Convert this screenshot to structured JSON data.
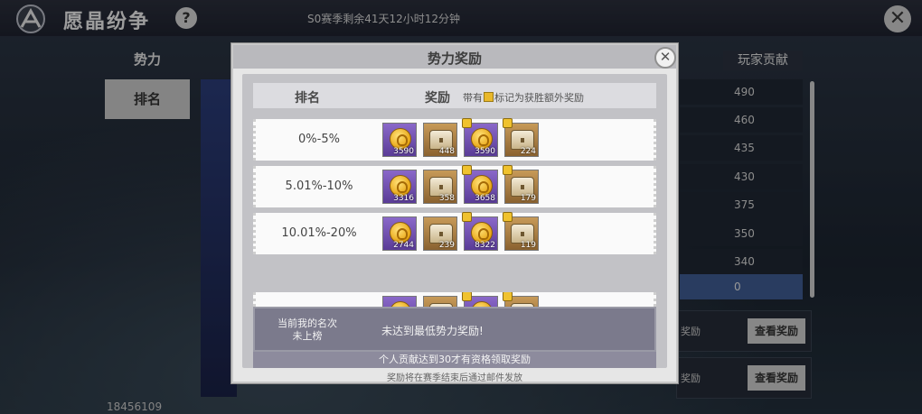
{
  "header": {
    "title": "愿晶纷争",
    "help_label": "?",
    "season_timer": "S0赛季剩余41天12小时12分钟",
    "close_label": "✕"
  },
  "sidebar": {
    "items": [
      {
        "label": "势力"
      },
      {
        "label": "排名"
      }
    ]
  },
  "background_list": {
    "column_header": "玩家贡献",
    "scores": [
      "490",
      "460",
      "435",
      "430",
      "375",
      "350",
      "340",
      "0"
    ],
    "cards": [
      {
        "label": "奖励",
        "button": "查看奖励"
      },
      {
        "label": "奖励",
        "button": "查看奖励"
      }
    ]
  },
  "user_id": "18456109",
  "modal": {
    "title": "势力奖励",
    "close_label": "✕",
    "table_header": {
      "rank": "排名",
      "reward": "奖励",
      "note_before": "带有",
      "note_after": "标记为获胜额外奖励"
    },
    "rows": [
      {
        "rank": "0%-5%",
        "items": [
          {
            "kind": "coin",
            "bg": "purple",
            "qty": "3590",
            "star": false
          },
          {
            "kind": "chest",
            "bg": "gold",
            "qty": "448",
            "star": false
          },
          {
            "kind": "coin",
            "bg": "purple",
            "qty": "3590",
            "star": true
          },
          {
            "kind": "chest",
            "bg": "gold",
            "qty": "224",
            "star": true
          }
        ]
      },
      {
        "rank": "5.01%-10%",
        "items": [
          {
            "kind": "coin",
            "bg": "purple",
            "qty": "3316",
            "star": false
          },
          {
            "kind": "chest",
            "bg": "gold",
            "qty": "358",
            "star": false
          },
          {
            "kind": "coin",
            "bg": "purple",
            "qty": "3658",
            "star": true
          },
          {
            "kind": "chest",
            "bg": "gold",
            "qty": "179",
            "star": true
          }
        ]
      },
      {
        "rank": "10.01%-20%",
        "items": [
          {
            "kind": "coin",
            "bg": "purple",
            "qty": "2744",
            "star": false
          },
          {
            "kind": "chest",
            "bg": "gold",
            "qty": "239",
            "star": false
          },
          {
            "kind": "coin",
            "bg": "purple",
            "qty": "8322",
            "star": true
          },
          {
            "kind": "chest",
            "bg": "gold",
            "qty": "119",
            "star": true
          }
        ]
      },
      {
        "rank": "",
        "items": [
          {
            "kind": "coin",
            "bg": "purple",
            "qty": "",
            "star": false
          },
          {
            "kind": "chest",
            "bg": "gold",
            "qty": "",
            "star": false
          },
          {
            "kind": "coin",
            "bg": "purple",
            "qty": "",
            "star": true
          },
          {
            "kind": "chest",
            "bg": "gold",
            "qty": "",
            "star": true
          }
        ]
      }
    ],
    "my_rank": {
      "label_line1": "当前我的名次",
      "label_line2": "未上榜",
      "message": "未达到最低势力奖励!"
    },
    "contribution_note": "个人贡献达到30才有资格领取奖励",
    "footer_note": "奖励将在赛季结束后通过邮件发放"
  }
}
